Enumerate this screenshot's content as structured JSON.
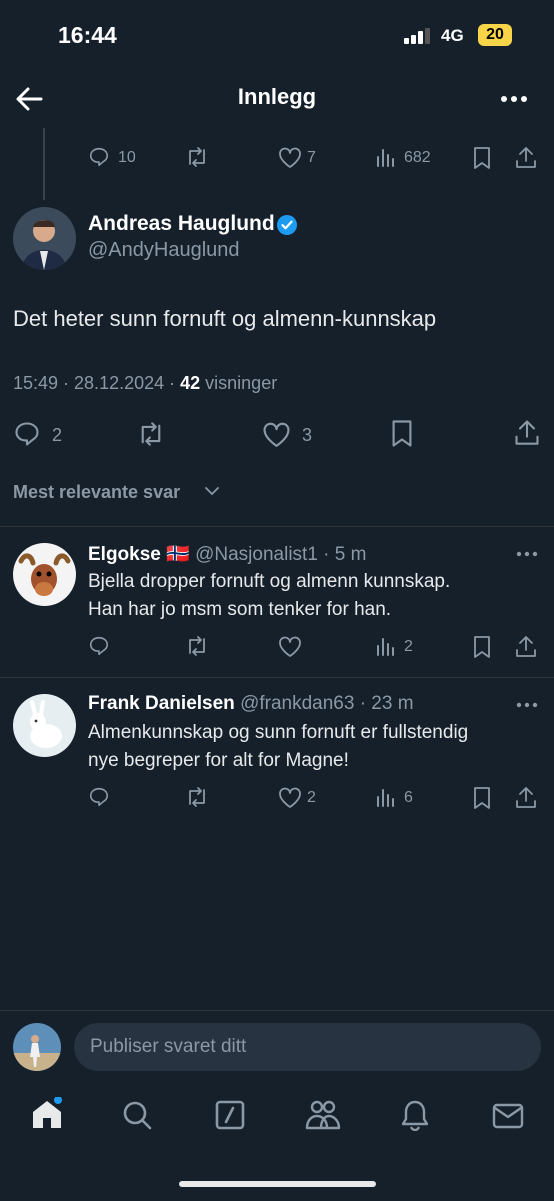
{
  "status": {
    "time": "16:44",
    "network": "4G",
    "battery": "20"
  },
  "header": {
    "title": "Innlegg"
  },
  "prev_tweet": {
    "replies": "10",
    "likes": "7",
    "views": "682"
  },
  "main_tweet": {
    "name": "Andreas Hauglund",
    "handle": "@AndyHauglund",
    "text": "Det heter sunn fornuft og almenn-kunnskap",
    "time": "15:49 · 28.12.2024 · ",
    "views_count": "42",
    "views_label": " visninger",
    "replies": "2",
    "likes": "3"
  },
  "sort_label": "Mest relevante svar",
  "replies": [
    {
      "name": "Elgokse",
      "flag": "🇳🇴",
      "meta": "@Nasjonalist1 · 5 m",
      "text_line1": "Bjella dropper fornuft og almenn kunnskap.",
      "text_line2": "Han har jo msm som tenker for han.",
      "replies": "",
      "likes": "",
      "views": "2"
    },
    {
      "name": "Frank Danielsen",
      "meta": "@frankdan63 · 23 m",
      "text_line1": "Almenkunnskap og sunn fornuft er fullstendig",
      "text_line2": "nye begreper for alt for Magne!",
      "replies": "",
      "likes": "2",
      "views": "6"
    }
  ],
  "compose": {
    "placeholder": "Publiser svaret ditt"
  },
  "colors": {
    "background": "#15202b",
    "accent": "#1d9bf0",
    "muted": "#8b98a5",
    "verified": "#1d9bf0"
  }
}
